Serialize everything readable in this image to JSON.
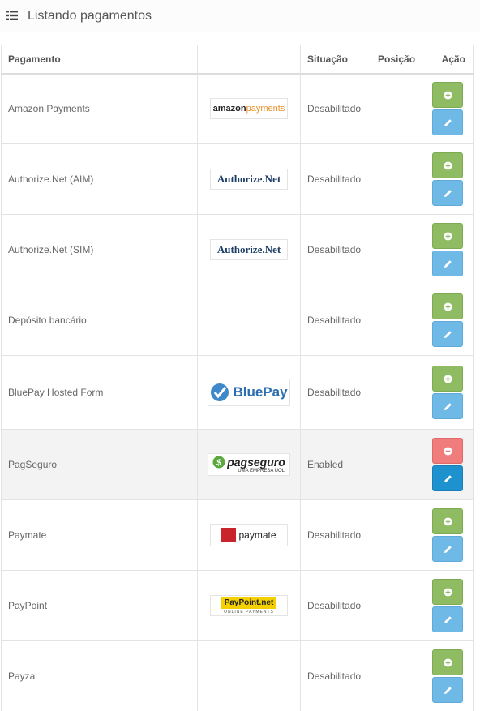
{
  "header": {
    "title": "Listando pagamentos",
    "icon": "list-icon"
  },
  "table": {
    "columns": [
      "Pagamento",
      "",
      "Situação",
      "Posição",
      "Ação"
    ],
    "rows": [
      {
        "name": "Amazon Payments",
        "logo": "amazon-payments",
        "logo_text": [
          "amazon",
          "payments"
        ],
        "status": "Desabilitado",
        "position": "",
        "installed": false
      },
      {
        "name": "Authorize.Net (AIM)",
        "logo": "authorize-net",
        "logo_text": [
          "Authorize.Net"
        ],
        "status": "Desabilitado",
        "position": "",
        "installed": false
      },
      {
        "name": "Authorize.Net (SIM)",
        "logo": "authorize-net",
        "logo_text": [
          "Authorize.Net"
        ],
        "status": "Desabilitado",
        "position": "",
        "installed": false
      },
      {
        "name": "Depósito bancário",
        "logo": "",
        "logo_text": [],
        "status": "Desabilitado",
        "position": "",
        "installed": false
      },
      {
        "name": "BluePay Hosted Form",
        "logo": "bluepay",
        "logo_text": [
          "BluePay"
        ],
        "status": "Desabilitado",
        "position": "",
        "installed": false
      },
      {
        "name": "PagSeguro",
        "logo": "pagseguro",
        "logo_text": [
          "pagseguro",
          "UMA EMPRESA UOL"
        ],
        "status": "Enabled",
        "position": "",
        "installed": true
      },
      {
        "name": "Paymate",
        "logo": "paymate",
        "logo_text": [
          "paymate"
        ],
        "status": "Desabilitado",
        "position": "",
        "installed": false
      },
      {
        "name": "PayPoint",
        "logo": "paypoint",
        "logo_text": [
          "PayPoint.net",
          "ONLINE PAYMENTS"
        ],
        "status": "Desabilitado",
        "position": "",
        "installed": false
      },
      {
        "name": "Payza",
        "logo": "",
        "logo_text": [],
        "status": "Desabilitado",
        "position": "",
        "installed": false
      }
    ]
  },
  "colors": {
    "install": "#8fbb62",
    "uninstall": "#f07c7c",
    "edit": "#6fb9e6",
    "edit_active": "#1e91cf"
  }
}
